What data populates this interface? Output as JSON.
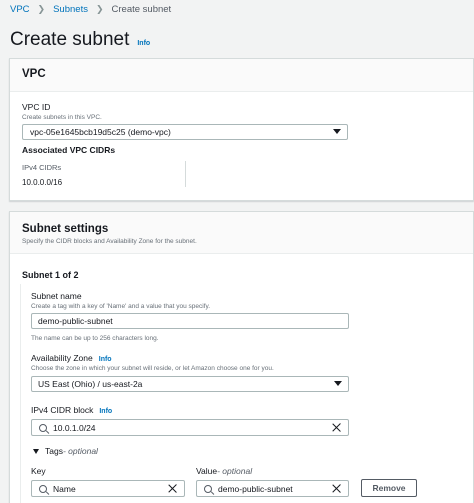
{
  "breadcrumb": {
    "items": [
      "VPC",
      "Subnets",
      "Create subnet"
    ]
  },
  "page": {
    "title": "Create subnet",
    "info": "Info"
  },
  "vpc_panel": {
    "title": "VPC",
    "vpc_id_label": "VPC ID",
    "vpc_id_desc": "Create subnets in this VPC.",
    "vpc_id_value": "vpc-05e1645bcb19d5c25 (demo-vpc)",
    "cidrs_heading": "Associated VPC CIDRs",
    "ipv4_label": "IPv4 CIDRs",
    "ipv4_value": "10.0.0.0/16"
  },
  "settings_panel": {
    "title": "Subnet settings",
    "desc": "Specify the CIDR blocks and Availability Zone for the subnet.",
    "subnet_counter": "Subnet 1 of 2",
    "subnet_name_label": "Subnet name",
    "subnet_name_desc": "Create a tag with a key of 'Name' and a value that you specify.",
    "subnet_name_value": "demo-public-subnet",
    "subnet_name_hint": "The name can be up to 256 characters long.",
    "az_label": "Availability Zone",
    "az_info": "Info",
    "az_desc": "Choose the zone in which your subnet will reside, or let Amazon choose one for you.",
    "az_value": "US East (Ohio) / us-east-2a",
    "cidr_label": "IPv4 CIDR block",
    "cidr_info": "Info",
    "cidr_value": "10.0.1.0/24",
    "tags_label": "Tags",
    "tags_optional": " - optional",
    "key_label": "Key",
    "value_label": "Value",
    "value_optional": " - optional",
    "key_value": "Name",
    "value_value": "demo-public-subnet",
    "remove_label": "Remove"
  },
  "colors": {
    "link": "#0073bb",
    "background": "#f2f3f3",
    "border": "#aab7b8"
  }
}
